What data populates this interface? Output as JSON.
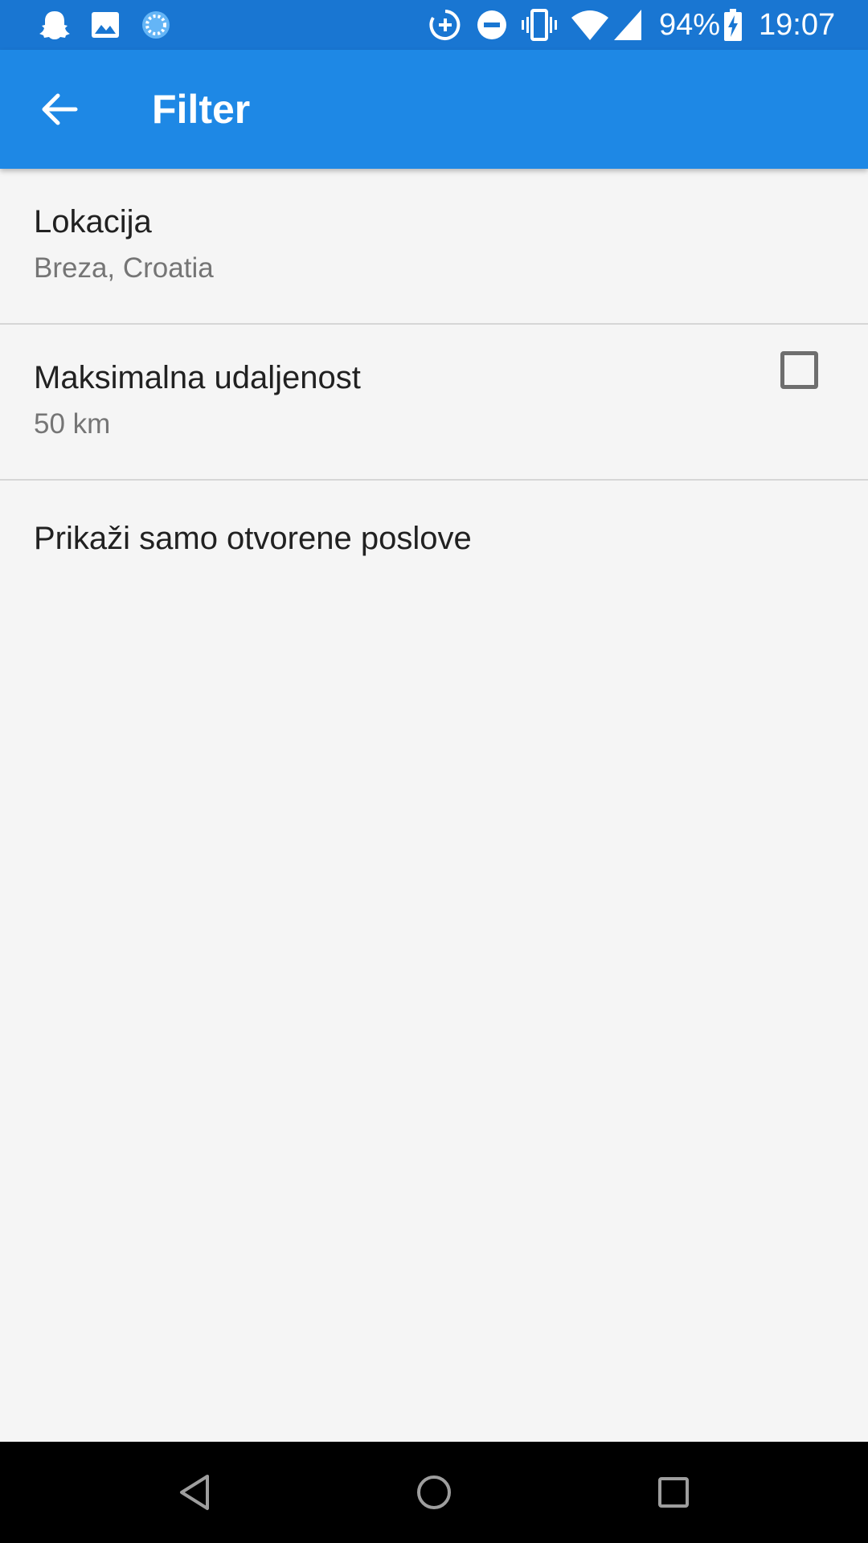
{
  "status_bar": {
    "battery": "94%",
    "time": "19:07",
    "left_icons": [
      "snapchat-ghost-icon",
      "image-icon",
      "sync-icon"
    ],
    "right_icons": [
      "data-saver-icon",
      "do-not-disturb-icon",
      "vibrate-icon",
      "wifi-icon",
      "cell-signal-icon",
      "battery-charging-icon"
    ]
  },
  "app_bar": {
    "title": "Filter",
    "back_icon": "arrow-back-icon"
  },
  "preferences": [
    {
      "title": "Lokacija",
      "summary": "Breza, Croatia"
    },
    {
      "title": "Maksimalna udaljenost",
      "summary": "50 km"
    }
  ],
  "checkbox_preference": {
    "title": "Prikaži samo otvorene poslove",
    "checked": false
  },
  "nav_bar": {
    "icons": [
      "back-triangle-icon",
      "home-circle-icon",
      "recents-square-icon"
    ]
  },
  "colors": {
    "status_bar": "#1976d2",
    "app_bar": "#1e88e5",
    "background": "#f5f5f5",
    "divider": "#d6d6d6",
    "checkbox_border": "#6e6e6e"
  }
}
